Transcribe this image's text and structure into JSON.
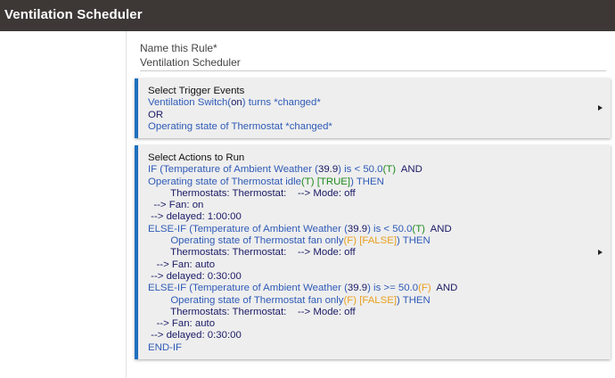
{
  "app": {
    "title": "Ventilation Scheduler"
  },
  "name_field": {
    "label": "Name this Rule*",
    "value": "Ventilation Scheduler"
  },
  "colors": {
    "topbar": "#3d3836",
    "card_accent": "#1f6fbf",
    "rule_blue": "#2f5bb7",
    "true_green": "#1e8a1e",
    "false_orange": "#e8a020"
  },
  "trigger": {
    "heading": "Select Trigger Events",
    "line1": [
      {
        "text": "Ventilation Switch(",
        "color": "blue"
      },
      {
        "text": "on",
        "color": "navy"
      },
      {
        "text": ") turns *changed*",
        "color": "blue"
      }
    ],
    "or_text": "OR",
    "line3": "Operating state of Thermostat *changed*",
    "expand_icon": "triangle-right-icon"
  },
  "actions": {
    "heading": "Select Actions to Run",
    "expand_icon": "triangle-right-icon",
    "lines": [
      [
        {
          "text": "IF (Temperature of Ambient Weather (",
          "color": "blue"
        },
        {
          "text": "39.9",
          "color": "navy"
        },
        {
          "text": ") is < 50.0",
          "color": "blue"
        },
        {
          "text": "(T)",
          "color": "green"
        },
        {
          "text": "  AND",
          "color": "navy"
        }
      ],
      [
        {
          "text": "Operating state of Thermostat idle",
          "color": "blue"
        },
        {
          "text": "(T)",
          "color": "green"
        },
        {
          "text": " [TRUE]",
          "color": "green"
        },
        {
          "text": ") THEN",
          "color": "blue"
        }
      ],
      [
        {
          "text": "        Thermostats: Thermostat:    --> Mode: off",
          "color": "navy"
        }
      ],
      [
        {
          "text": "  --> Fan: on",
          "color": "navy"
        }
      ],
      [
        {
          "text": " --> delayed: 1:00:00",
          "color": "navy"
        }
      ],
      [
        {
          "text": "ELSE-IF (Temperature of Ambient Weather (",
          "color": "blue"
        },
        {
          "text": "39.9",
          "color": "navy"
        },
        {
          "text": ") is < 50.0",
          "color": "blue"
        },
        {
          "text": "(T)",
          "color": "green"
        },
        {
          "text": "  AND",
          "color": "navy"
        }
      ],
      [
        {
          "text": "        Operating state of Thermostat fan only",
          "color": "blue"
        },
        {
          "text": "(F)",
          "color": "orange"
        },
        {
          "text": " [FALSE]",
          "color": "orange"
        },
        {
          "text": ") THEN",
          "color": "blue"
        }
      ],
      [
        {
          "text": "        Thermostats: Thermostat:    --> Mode: off",
          "color": "navy"
        }
      ],
      [
        {
          "text": "   --> Fan: auto",
          "color": "navy"
        }
      ],
      [
        {
          "text": " --> delayed: 0:30:00",
          "color": "navy"
        }
      ],
      [
        {
          "text": "ELSE-IF (Temperature of Ambient Weather (",
          "color": "blue"
        },
        {
          "text": "39.9",
          "color": "navy"
        },
        {
          "text": ") is >= 50.0",
          "color": "blue"
        },
        {
          "text": "(F)",
          "color": "orange"
        },
        {
          "text": "  AND",
          "color": "navy"
        }
      ],
      [
        {
          "text": "        Operating state of Thermostat fan only",
          "color": "blue"
        },
        {
          "text": "(F)",
          "color": "orange"
        },
        {
          "text": " [FALSE]",
          "color": "orange"
        },
        {
          "text": ") THEN",
          "color": "blue"
        }
      ],
      [
        {
          "text": "        Thermostats: Thermostat:    --> Mode: off",
          "color": "navy"
        }
      ],
      [
        {
          "text": "   --> Fan: auto",
          "color": "navy"
        }
      ],
      [
        {
          "text": " --> delayed: 0:30:00",
          "color": "navy"
        }
      ],
      [
        {
          "text": "END-IF",
          "color": "blue"
        }
      ]
    ]
  }
}
